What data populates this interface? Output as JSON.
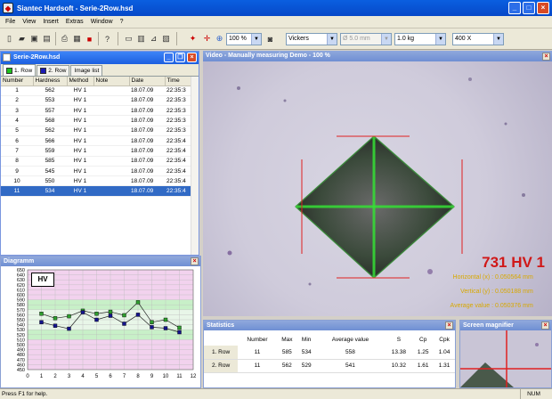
{
  "app": {
    "title": "Siantec Hardsoft - Serie-2Row.hsd"
  },
  "menu": [
    "File",
    "View",
    "Insert",
    "Extras",
    "Window",
    "?"
  ],
  "toolbar": {
    "zoom": "100 %",
    "method": "Vickers",
    "diameter": "Ø 5.0 mm",
    "load": "1.0 kg",
    "magnification": "400 X"
  },
  "series_window": {
    "title": "Serie-2Row.hsd",
    "tabs": [
      "1. Row",
      "2. Row",
      "Image list"
    ],
    "columns": [
      "Number",
      "Hardness",
      "Method",
      "Note",
      "Date",
      "Time"
    ],
    "rows": [
      [
        "1",
        "562",
        "HV 1",
        "",
        "18.07.09",
        "22:35:3"
      ],
      [
        "2",
        "553",
        "HV 1",
        "",
        "18.07.09",
        "22:35:3"
      ],
      [
        "3",
        "557",
        "HV 1",
        "",
        "18.07.09",
        "22:35:3"
      ],
      [
        "4",
        "568",
        "HV 1",
        "",
        "18.07.09",
        "22:35:3"
      ],
      [
        "5",
        "562",
        "HV 1",
        "",
        "18.07.09",
        "22:35:3"
      ],
      [
        "6",
        "566",
        "HV 1",
        "",
        "18.07.09",
        "22:35:4"
      ],
      [
        "7",
        "559",
        "HV 1",
        "",
        "18.07.09",
        "22:35:4"
      ],
      [
        "8",
        "585",
        "HV 1",
        "",
        "18.07.09",
        "22:35:4"
      ],
      [
        "9",
        "545",
        "HV 1",
        "",
        "18.07.09",
        "22:35:4"
      ],
      [
        "10",
        "550",
        "HV 1",
        "",
        "18.07.09",
        "22:35:4"
      ],
      [
        "11",
        "534",
        "HV 1",
        "",
        "18.07.09",
        "22:35:4"
      ]
    ],
    "selected_row": 10
  },
  "video": {
    "title": "Video - Manually measuring Demo - 100 %",
    "result": "731 HV 1",
    "horizontal_label": "Horizontal (x) :",
    "horizontal_value": "0.050564 mm",
    "vertical_label": "Vertical (y) :",
    "vertical_value": "0.050188 mm",
    "average_label": "Average value :",
    "average_value": "0.050376 mm"
  },
  "diagram": {
    "title": "Diagramm",
    "label": "HV"
  },
  "chart_data": {
    "type": "line",
    "x": [
      1,
      2,
      3,
      4,
      5,
      6,
      7,
      8,
      9,
      10,
      11
    ],
    "series": [
      {
        "name": "1. Row",
        "values": [
          562,
          553,
          557,
          568,
          562,
          566,
          559,
          585,
          545,
          550,
          534
        ],
        "color": "#2e9e2e"
      },
      {
        "name": "2. Row",
        "values": [
          545,
          538,
          532,
          565,
          550,
          558,
          542,
          560,
          535,
          533,
          525
        ],
        "color": "#14148c"
      }
    ],
    "xlim": [
      0,
      12
    ],
    "ylim": [
      450,
      650
    ],
    "xticks": [
      0,
      1,
      2,
      3,
      4,
      5,
      6,
      7,
      8,
      9,
      10,
      11,
      12
    ],
    "yticks": [
      450,
      460,
      470,
      480,
      490,
      500,
      510,
      520,
      530,
      540,
      550,
      560,
      570,
      580,
      590,
      600,
      610,
      620,
      630,
      640,
      650
    ],
    "grid": true
  },
  "statistics": {
    "title": "Statistics",
    "columns": [
      "",
      "Number",
      "Max",
      "Min",
      "Average value",
      "S",
      "Cp",
      "Cpk"
    ],
    "rows": [
      [
        "1. Row",
        "11",
        "585",
        "534",
        "558",
        "13.38",
        "1.25",
        "1.04"
      ],
      [
        "2. Row",
        "11",
        "562",
        "529",
        "541",
        "10.32",
        "1.61",
        "1.31"
      ]
    ]
  },
  "magnifier": {
    "title": "Screen magnifier"
  },
  "status": {
    "help": "Press F1 for help.",
    "num": "NUM"
  }
}
